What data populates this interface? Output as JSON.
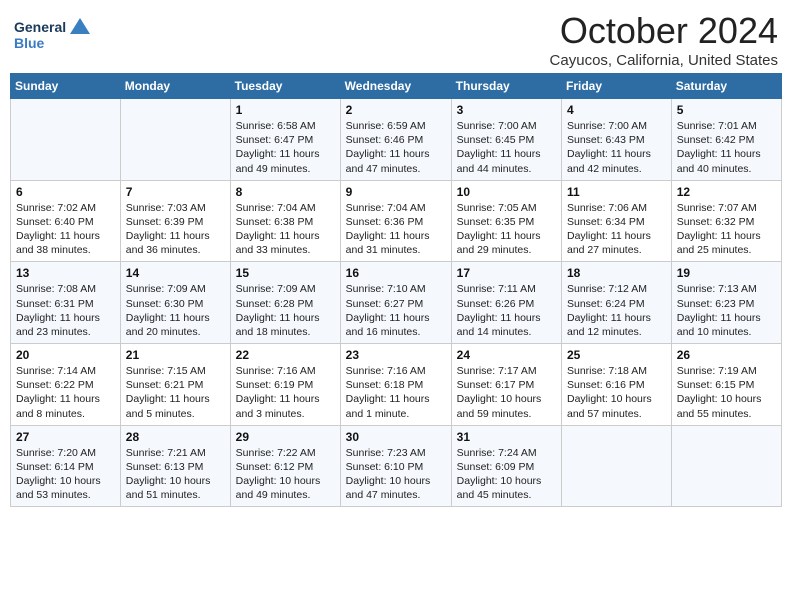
{
  "logo": {
    "line1": "General",
    "line2": "Blue"
  },
  "title": "October 2024",
  "location": "Cayucos, California, United States",
  "headers": [
    "Sunday",
    "Monday",
    "Tuesday",
    "Wednesday",
    "Thursday",
    "Friday",
    "Saturday"
  ],
  "weeks": [
    [
      {
        "day": "",
        "info": ""
      },
      {
        "day": "",
        "info": ""
      },
      {
        "day": "1",
        "info": "Sunrise: 6:58 AM\nSunset: 6:47 PM\nDaylight: 11 hours and 49 minutes."
      },
      {
        "day": "2",
        "info": "Sunrise: 6:59 AM\nSunset: 6:46 PM\nDaylight: 11 hours and 47 minutes."
      },
      {
        "day": "3",
        "info": "Sunrise: 7:00 AM\nSunset: 6:45 PM\nDaylight: 11 hours and 44 minutes."
      },
      {
        "day": "4",
        "info": "Sunrise: 7:00 AM\nSunset: 6:43 PM\nDaylight: 11 hours and 42 minutes."
      },
      {
        "day": "5",
        "info": "Sunrise: 7:01 AM\nSunset: 6:42 PM\nDaylight: 11 hours and 40 minutes."
      }
    ],
    [
      {
        "day": "6",
        "info": "Sunrise: 7:02 AM\nSunset: 6:40 PM\nDaylight: 11 hours and 38 minutes."
      },
      {
        "day": "7",
        "info": "Sunrise: 7:03 AM\nSunset: 6:39 PM\nDaylight: 11 hours and 36 minutes."
      },
      {
        "day": "8",
        "info": "Sunrise: 7:04 AM\nSunset: 6:38 PM\nDaylight: 11 hours and 33 minutes."
      },
      {
        "day": "9",
        "info": "Sunrise: 7:04 AM\nSunset: 6:36 PM\nDaylight: 11 hours and 31 minutes."
      },
      {
        "day": "10",
        "info": "Sunrise: 7:05 AM\nSunset: 6:35 PM\nDaylight: 11 hours and 29 minutes."
      },
      {
        "day": "11",
        "info": "Sunrise: 7:06 AM\nSunset: 6:34 PM\nDaylight: 11 hours and 27 minutes."
      },
      {
        "day": "12",
        "info": "Sunrise: 7:07 AM\nSunset: 6:32 PM\nDaylight: 11 hours and 25 minutes."
      }
    ],
    [
      {
        "day": "13",
        "info": "Sunrise: 7:08 AM\nSunset: 6:31 PM\nDaylight: 11 hours and 23 minutes."
      },
      {
        "day": "14",
        "info": "Sunrise: 7:09 AM\nSunset: 6:30 PM\nDaylight: 11 hours and 20 minutes."
      },
      {
        "day": "15",
        "info": "Sunrise: 7:09 AM\nSunset: 6:28 PM\nDaylight: 11 hours and 18 minutes."
      },
      {
        "day": "16",
        "info": "Sunrise: 7:10 AM\nSunset: 6:27 PM\nDaylight: 11 hours and 16 minutes."
      },
      {
        "day": "17",
        "info": "Sunrise: 7:11 AM\nSunset: 6:26 PM\nDaylight: 11 hours and 14 minutes."
      },
      {
        "day": "18",
        "info": "Sunrise: 7:12 AM\nSunset: 6:24 PM\nDaylight: 11 hours and 12 minutes."
      },
      {
        "day": "19",
        "info": "Sunrise: 7:13 AM\nSunset: 6:23 PM\nDaylight: 11 hours and 10 minutes."
      }
    ],
    [
      {
        "day": "20",
        "info": "Sunrise: 7:14 AM\nSunset: 6:22 PM\nDaylight: 11 hours and 8 minutes."
      },
      {
        "day": "21",
        "info": "Sunrise: 7:15 AM\nSunset: 6:21 PM\nDaylight: 11 hours and 5 minutes."
      },
      {
        "day": "22",
        "info": "Sunrise: 7:16 AM\nSunset: 6:19 PM\nDaylight: 11 hours and 3 minutes."
      },
      {
        "day": "23",
        "info": "Sunrise: 7:16 AM\nSunset: 6:18 PM\nDaylight: 11 hours and 1 minute."
      },
      {
        "day": "24",
        "info": "Sunrise: 7:17 AM\nSunset: 6:17 PM\nDaylight: 10 hours and 59 minutes."
      },
      {
        "day": "25",
        "info": "Sunrise: 7:18 AM\nSunset: 6:16 PM\nDaylight: 10 hours and 57 minutes."
      },
      {
        "day": "26",
        "info": "Sunrise: 7:19 AM\nSunset: 6:15 PM\nDaylight: 10 hours and 55 minutes."
      }
    ],
    [
      {
        "day": "27",
        "info": "Sunrise: 7:20 AM\nSunset: 6:14 PM\nDaylight: 10 hours and 53 minutes."
      },
      {
        "day": "28",
        "info": "Sunrise: 7:21 AM\nSunset: 6:13 PM\nDaylight: 10 hours and 51 minutes."
      },
      {
        "day": "29",
        "info": "Sunrise: 7:22 AM\nSunset: 6:12 PM\nDaylight: 10 hours and 49 minutes."
      },
      {
        "day": "30",
        "info": "Sunrise: 7:23 AM\nSunset: 6:10 PM\nDaylight: 10 hours and 47 minutes."
      },
      {
        "day": "31",
        "info": "Sunrise: 7:24 AM\nSunset: 6:09 PM\nDaylight: 10 hours and 45 minutes."
      },
      {
        "day": "",
        "info": ""
      },
      {
        "day": "",
        "info": ""
      }
    ]
  ]
}
